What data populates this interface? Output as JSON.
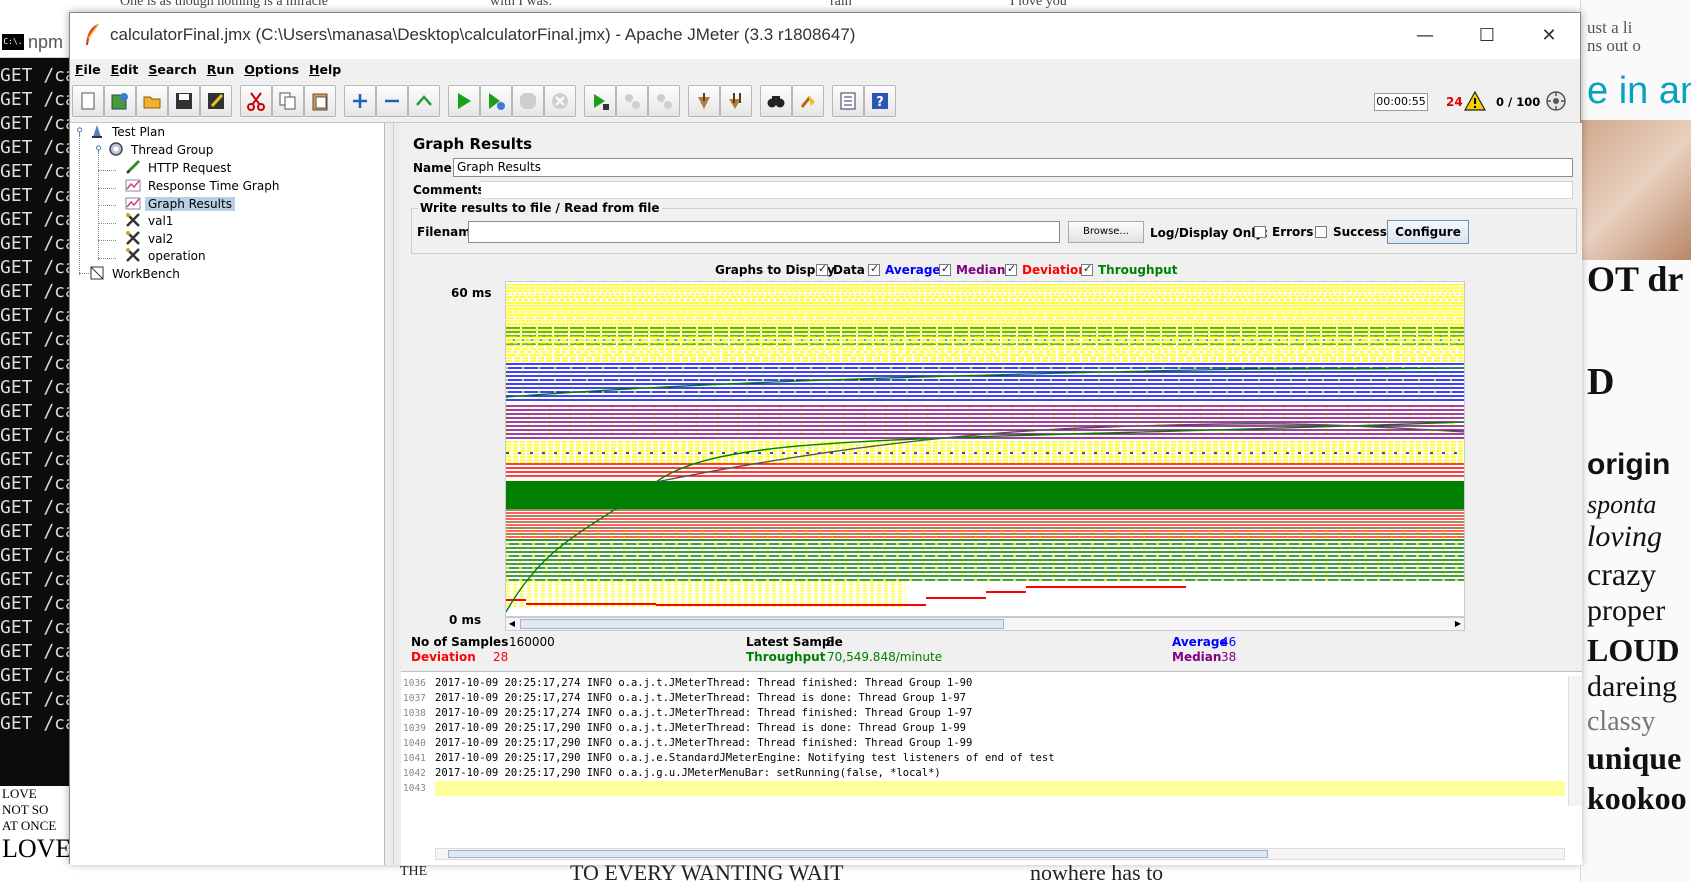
{
  "background": {
    "terminal": {
      "title": "npm",
      "icon_text": "C:\\.",
      "line_text": "GET /ca",
      "bottom_words": [
        "LOVE",
        "NOT SO",
        "AT ONCE",
        "LOVE ME"
      ]
    },
    "top_strip_words": [
      "One is as though nothing is a miracle",
      "with I was:",
      "rain",
      "I love you",
      "ust a li",
      "ns out o"
    ],
    "collage_words": [
      "e in an",
      "OT dr",
      "D",
      "origin",
      "sponta",
      "loving",
      "crazy",
      "proper",
      "LOUD",
      "dareing",
      "classy",
      "unique",
      "kookoo"
    ],
    "bottom_strip_words": [
      "THE",
      "TO EVERY WANTING WAIT",
      "nowhere has to"
    ]
  },
  "window": {
    "title": "calculatorFinal.jmx (C:\\Users\\manasa\\Desktop\\calculatorFinal.jmx) - Apache JMeter (3.3 r1808647)",
    "controls": {
      "minimize": "—",
      "maximize": "☐",
      "close": "✕"
    }
  },
  "menu": [
    "File",
    "Edit",
    "Search",
    "Run",
    "Options",
    "Help"
  ],
  "toolbar": {
    "buttons": [
      "new-icon",
      "templates-icon",
      "open-icon",
      "save-icon",
      "save-as-icon",
      "cut-icon",
      "copy-icon",
      "paste-icon",
      "expand-icon",
      "collapse-icon",
      "toggle-icon",
      "start-icon",
      "start-no-pause-icon",
      "stop-icon",
      "shutdown-icon",
      "remote-start-icon",
      "remote-stop-icon",
      "remote-shutdown-icon",
      "clear-icon",
      "clear-all-icon",
      "search-icon",
      "reset-search-icon",
      "function-helper-icon",
      "help-icon"
    ],
    "elapsed_time": "00:00:55",
    "error_count": "24",
    "active_threads": "0 / 100"
  },
  "tree": {
    "nodes": [
      {
        "label": "Test Plan",
        "icon": "test-plan-icon"
      },
      {
        "label": "Thread Group",
        "icon": "thread-group-icon"
      },
      {
        "label": "HTTP Request",
        "icon": "sampler-icon"
      },
      {
        "label": "Response Time Graph",
        "icon": "listener-icon"
      },
      {
        "label": "Graph Results",
        "icon": "listener-icon",
        "selected": true
      },
      {
        "label": "val1",
        "icon": "assertion-icon"
      },
      {
        "label": "val2",
        "icon": "assertion-icon"
      },
      {
        "label": "operation",
        "icon": "assertion-icon"
      },
      {
        "label": "WorkBench",
        "icon": "workbench-icon"
      }
    ]
  },
  "panel": {
    "title": "Graph Results",
    "name_label": "Name:",
    "name_value": "Graph Results",
    "comments_label": "Comments:",
    "file_section_title": "Write results to file / Read from file",
    "filename_label": "Filename",
    "filename_value": "",
    "browse_label": "Browse...",
    "log_display_label": "Log/Display Only:",
    "errors_label": "Errors",
    "successes_label": "Successes",
    "errors_checked": false,
    "successes_checked": false,
    "configure_label": "Configure"
  },
  "graph_options": {
    "label": "Graphs to Display",
    "items": [
      {
        "label": "Data",
        "checked": true,
        "color": "#000000"
      },
      {
        "label": "Average",
        "checked": true,
        "color": "#0000ff"
      },
      {
        "label": "Median",
        "checked": true,
        "color": "#800080"
      },
      {
        "label": "Deviation",
        "checked": true,
        "color": "#ff0000"
      },
      {
        "label": "Throughput",
        "checked": true,
        "color": "#008000"
      }
    ]
  },
  "graph": {
    "y_max_label": "60 ms",
    "y_min_label": "0 ms",
    "colors": {
      "data": "#ffff00",
      "average": "#0000ff",
      "median": "#800080",
      "deviation": "#ff0000",
      "throughput": "#008000"
    }
  },
  "stats": {
    "samples_label": "No of Samples",
    "samples_value": "160000",
    "latest_label": "Latest Sample",
    "latest_value": "8",
    "average_label": "Average",
    "average_value": "46",
    "deviation_label": "Deviation",
    "deviation_value": "28",
    "throughput_label": "Throughput",
    "throughput_value": "70,549.848/minute",
    "median_label": "Median",
    "median_value": "38"
  },
  "log": {
    "line_numbers": [
      "1036",
      "1037",
      "1038",
      "1039",
      "1040",
      "1041",
      "1042",
      "1043"
    ],
    "lines": [
      "2017-10-09 20:25:17,274 INFO o.a.j.t.JMeterThread: Thread finished: Thread Group 1-90",
      "2017-10-09 20:25:17,274 INFO o.a.j.t.JMeterThread: Thread is done: Thread Group 1-97",
      "2017-10-09 20:25:17,274 INFO o.a.j.t.JMeterThread: Thread finished: Thread Group 1-97",
      "2017-10-09 20:25:17,290 INFO o.a.j.t.JMeterThread: Thread is done: Thread Group 1-99",
      "2017-10-09 20:25:17,290 INFO o.a.j.t.JMeterThread: Thread finished: Thread Group 1-99",
      "2017-10-09 20:25:17,290 INFO o.a.j.e.StandardJMeterEngine: Notifying test listeners of end of test",
      "2017-10-09 20:25:17,290 INFO o.a.j.g.u.JMeterMenuBar: setRunning(false, *local*)",
      ""
    ]
  }
}
